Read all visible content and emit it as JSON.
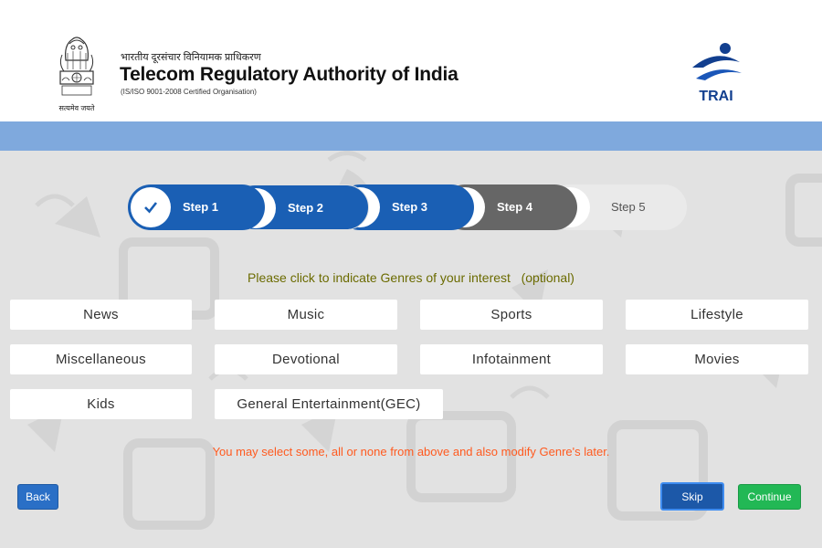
{
  "header": {
    "org_hindi": "भारतीय दूरसंचार विनियामक प्राधिकरण",
    "org_name": "Telecom Regulatory Authority of India",
    "org_cert": "(IS/ISO 9001-2008 Certified Organisation)",
    "emblem_motto": "सत्यमेव जयते",
    "logo_text": "TRAI"
  },
  "stepper": {
    "steps": [
      {
        "label": "Step 1",
        "number": "1",
        "state": "done"
      },
      {
        "label": "Step 2",
        "number": "2",
        "state": "done"
      },
      {
        "label": "Step 3",
        "number": "3",
        "state": "done"
      },
      {
        "label": "Step 4",
        "number": "4",
        "state": "current"
      },
      {
        "label": "Step 5",
        "number": "5",
        "state": "pending"
      }
    ]
  },
  "instruction": "Please click to indicate Genres of your interest   (optional)",
  "genres": [
    "News",
    "Music",
    "Sports",
    "Lifestyle",
    "Miscellaneous",
    "Devotional",
    "Infotainment",
    "Movies",
    "Kids",
    "General Entertainment(GEC)"
  ],
  "note": "You may select some, all or none from above and also modify Genre's later.",
  "buttons": {
    "back": "Back",
    "skip": "Skip",
    "continue": "Continue"
  },
  "colors": {
    "step_done": "#1a5fb4",
    "step_current": "#666666",
    "step_pending": "#eaeaea",
    "band": "#7fa9dd",
    "note_text": "#ff5a1f",
    "instruction_text": "#6b6b00",
    "continue": "#22b855",
    "skip": "#1c58a8"
  }
}
